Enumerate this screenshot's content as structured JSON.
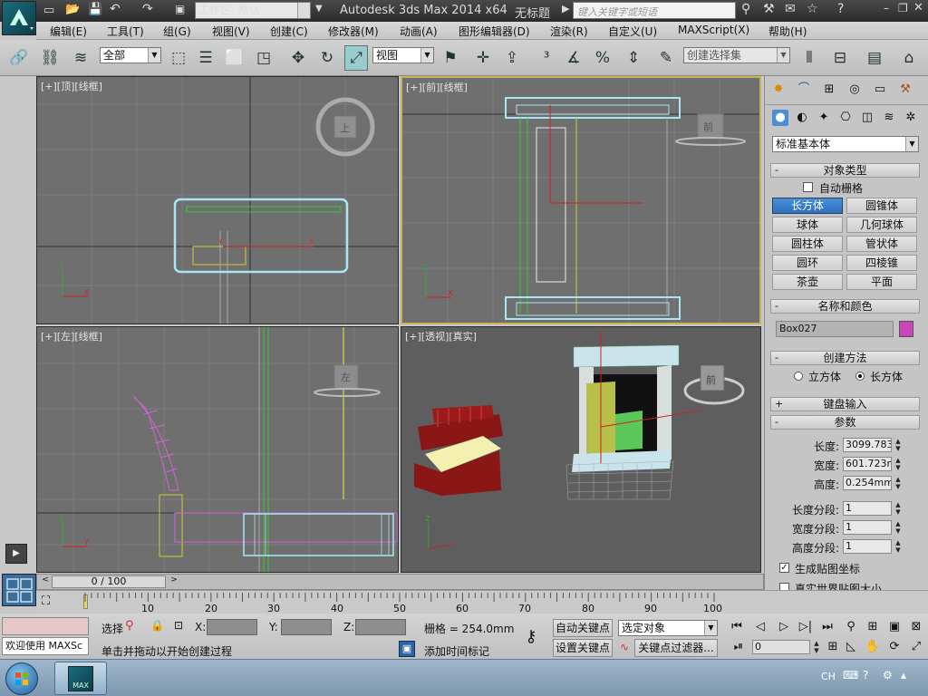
{
  "titlebar": {
    "workspace": "工作区: 默认",
    "title": "Autodesk 3ds Max  2014 x64",
    "doc": "无标题",
    "search_placeholder": "键入关键字或短语"
  },
  "menu": [
    "编辑(E)",
    "工具(T)",
    "组(G)",
    "视图(V)",
    "创建(C)",
    "修改器(M)",
    "动画(A)",
    "图形编辑器(D)",
    "渲染(R)",
    "自定义(U)",
    "MAXScript(X)",
    "帮助(H)"
  ],
  "toolbar": {
    "selection_filter": "全部",
    "ref_coord": "视图",
    "named_selection": "创建选择集"
  },
  "viewports": {
    "top": {
      "label": "[+][顶][线框]",
      "cube": "上"
    },
    "front": {
      "label": "[+][前][线框]",
      "cube": "前"
    },
    "left": {
      "label": "[+][左][线框]",
      "cube": "左"
    },
    "persp": {
      "label": "[+][透视][真实]",
      "cube": "前"
    }
  },
  "panel": {
    "category": "标准基本体",
    "object_type_title": "对象类型",
    "autogrid": "自动栅格",
    "object_buttons": [
      "长方体",
      "圆锥体",
      "球体",
      "几何球体",
      "圆柱体",
      "管状体",
      "圆环",
      "四棱锥",
      "茶壶",
      "平面"
    ],
    "name_color_title": "名称和颜色",
    "object_name": "Box027",
    "object_color": "#cc44bb",
    "creation_method_title": "创建方法",
    "method_cube": "立方体",
    "method_box": "长方体",
    "keyboard_title": "键盘输入",
    "params_title": "参数",
    "length_label": "长度:",
    "length_value": "3099.783",
    "width_label": "宽度:",
    "width_value": "601.723m",
    "height_label": "高度:",
    "height_value": "0.254mm",
    "lsegs_label": "长度分段:",
    "lsegs_value": "1",
    "wsegs_label": "宽度分段:",
    "wsegs_value": "1",
    "hsegs_label": "高度分段:",
    "hsegs_value": "1",
    "gen_map": "生成贴图坐标",
    "real_world": "真实世界贴图大小"
  },
  "timeline": {
    "frame": "0 / 100",
    "ticks": [
      "10",
      "20",
      "30",
      "40",
      "50",
      "60",
      "70",
      "80",
      "90",
      "100"
    ]
  },
  "status": {
    "maxscript": "欢迎使用 MAXSc",
    "selected": "选择",
    "x_label": "X:",
    "y_label": "Y:",
    "z_label": "Z:",
    "grid": "栅格 = 254.0mm",
    "prompt": "单击并拖动以开始创建过程",
    "add_time_tag": "添加时间标记",
    "auto_key": "自动关键点",
    "set_key": "设置关键点",
    "key_mode": "选定对象",
    "key_filters": "关键点过滤器...",
    "frame_field": "0"
  },
  "taskbar": {
    "lang": "CH",
    "app_label": "MAX"
  }
}
